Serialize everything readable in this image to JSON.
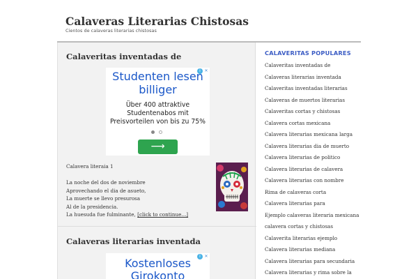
{
  "site": {
    "title": "Calaveras Literarias Chistosas",
    "description": "Cientos de calaveras literarias chistosas"
  },
  "posts": [
    {
      "title": "Calaveritas inventadas de",
      "ad": {
        "headline_1": "Studenten lesen",
        "headline_2": "billiger",
        "body": [
          "Über 400 attraktive",
          "Studentenabos mit",
          "Preisvorteilen von bis zu 75%"
        ],
        "cta_icon": "arrow-right-icon",
        "close_icon": "close-icon",
        "info_icon": "info-icon"
      },
      "excerpt_lines": [
        "Calavera literaia 1",
        "",
        "La noche del dos de noviembre",
        "Aprovechando el dia de asueto,",
        "La muerte se llevo presurosa",
        "Al de la presidencia.",
        "La huesuda fue fulminante,"
      ],
      "continue_label": "[click to continue...]"
    },
    {
      "title": "Calaveras literarias inventada",
      "ad": {
        "headline_1": "Kostenloses",
        "headline_2": "Girokonto"
      }
    }
  ],
  "sidebar": {
    "heading": "CALAVERITAS POPULARES",
    "items": [
      "Calaveritas inventadas de",
      "Calaveras literarias inventada",
      "Calaveritas inventadas literarias",
      "Calaveras de muertos literarias",
      "Calaveritas cortas y chistosas",
      "Calavera cortas mexicana",
      "Calavera literarias mexicana larga",
      "Calavera literarias dia de muerto",
      "Calavera literarias de politico",
      "Calavera literarias de calavera",
      "Calavera literarias con nombre",
      "Rima de calaveras corta",
      "Calavera literarias para",
      "Ejemplo calaveras literaria mexicana",
      "calavera cortas y chistosas",
      "Calaverita literarias ejemplo",
      "Calavera literarias mediana",
      "Calavera literarias para secundaria",
      "Calavera literarias y rima sobre la"
    ]
  },
  "colors": {
    "accent_link": "#3b5cc4",
    "ad_headline": "#1a57c8",
    "ad_cta": "#2ea44f"
  }
}
